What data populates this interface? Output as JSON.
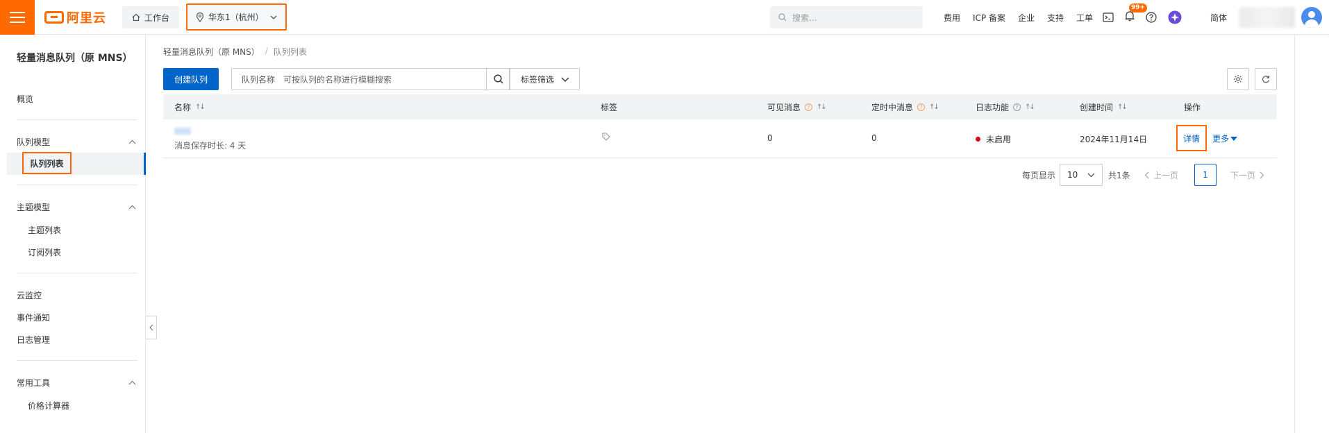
{
  "brand": {
    "logo_text": "阿里云",
    "accent": "#ff6a00",
    "link_color": "#0064c8"
  },
  "topbar": {
    "workbench": "工作台",
    "region": "华东1（杭州）",
    "search_placeholder": "搜索...",
    "links": [
      "费用",
      "ICP 备案",
      "企业",
      "支持",
      "工单"
    ],
    "notification_count": "99+",
    "language": "简体"
  },
  "sidebar": {
    "title": "轻量消息队列（原 MNS）",
    "overview": "概览",
    "group_queue": "队列模型",
    "queue_list": "队列列表",
    "group_topic": "主题模型",
    "topic_list": "主题列表",
    "subscription_list": "订阅列表",
    "cloud_monitor": "云监控",
    "event_notify": "事件通知",
    "log_manage": "日志管理",
    "group_tools": "常用工具",
    "price_calc": "价格计算器"
  },
  "breadcrumb": {
    "parent": "轻量消息队列（原 MNS）",
    "current": "队列列表"
  },
  "toolbar": {
    "create_label": "创建队列",
    "search_field_label": "队列名称",
    "search_placeholder": "可按队列的名称进行模糊搜索",
    "tag_filter_label": "标签筛选"
  },
  "table": {
    "headers": {
      "name": "名称",
      "tags": "标签",
      "visible": "可见消息",
      "delayed": "定时中消息",
      "logging": "日志功能",
      "created": "创建时间",
      "actions": "操作"
    },
    "rows": [
      {
        "retention": "消息保存时长: 4 天",
        "visible": "0",
        "delayed": "0",
        "logging": "未启用",
        "created": "2024年11月14日",
        "detail": "详情",
        "more": "更多"
      }
    ]
  },
  "pagination": {
    "per_page_label": "每页显示",
    "per_page": "10",
    "total": "共1条",
    "prev": "上一页",
    "current_page": "1",
    "next": "下一页"
  }
}
